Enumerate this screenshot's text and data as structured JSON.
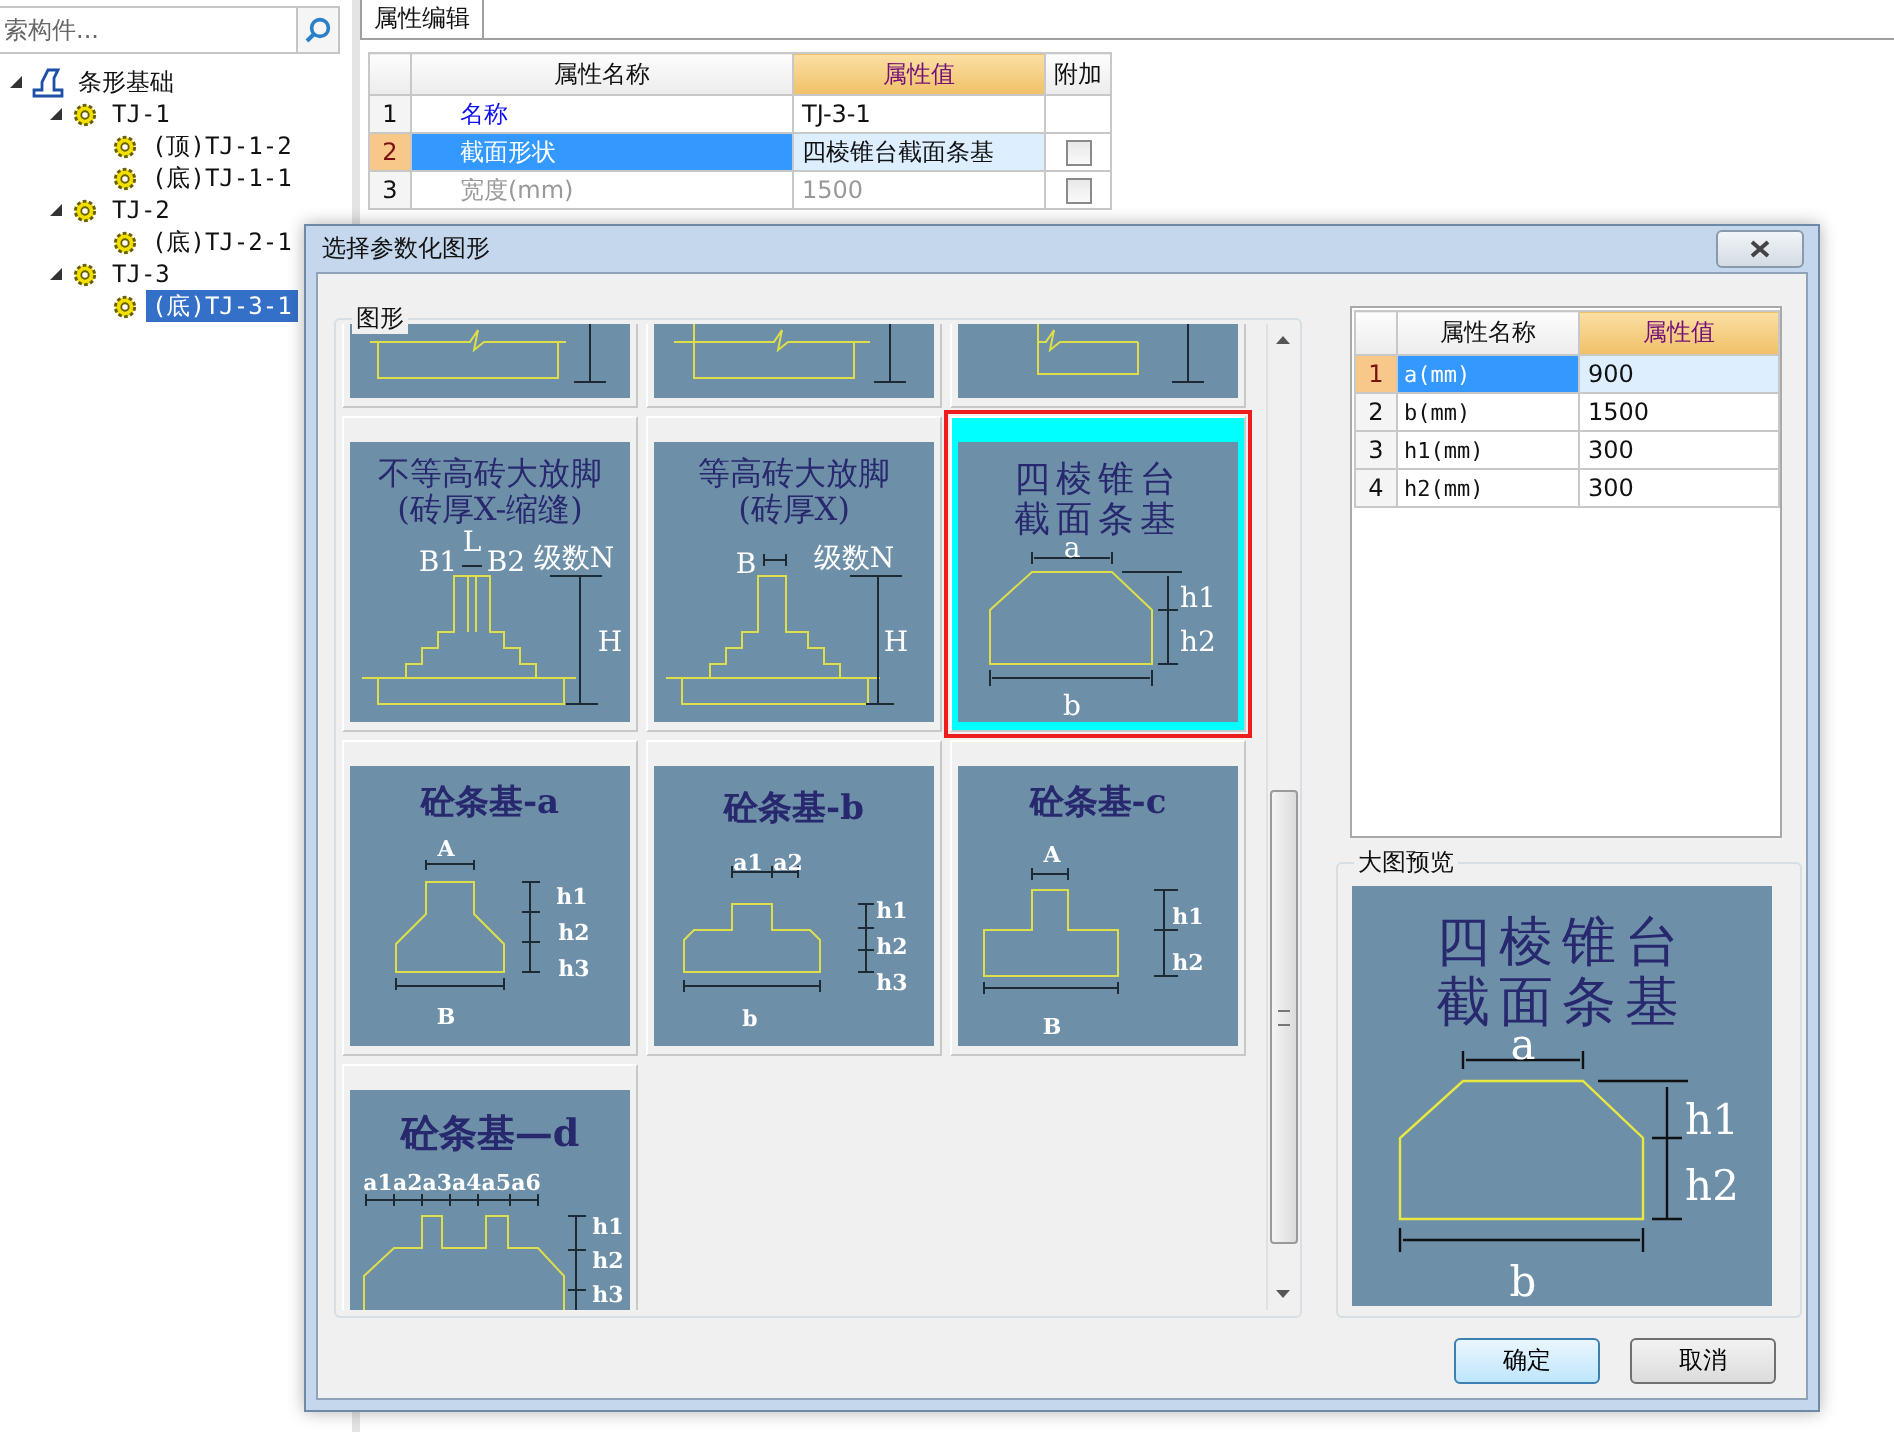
{
  "search": {
    "placeholder": "索构件..."
  },
  "tree": [
    {
      "label": "条形基础",
      "kind": "folder",
      "expanded": true,
      "selected": false,
      "children": [
        {
          "label": "TJ-1",
          "kind": "component",
          "expanded": true,
          "selected": false,
          "children": [
            {
              "label": "(顶)TJ-1-2",
              "kind": "component",
              "selected": false
            },
            {
              "label": "(底)TJ-1-1",
              "kind": "component",
              "selected": false
            }
          ]
        },
        {
          "label": "TJ-2",
          "kind": "component",
          "expanded": true,
          "selected": false,
          "children": [
            {
              "label": "(底)TJ-2-1",
              "kind": "component",
              "selected": false
            }
          ]
        },
        {
          "label": "TJ-3",
          "kind": "component",
          "expanded": true,
          "selected": false,
          "children": [
            {
              "label": "(底)TJ-3-1",
              "kind": "component",
              "selected": true
            }
          ]
        }
      ]
    }
  ],
  "property_editor": {
    "tab": "属性编辑",
    "columns": [
      "属性名称",
      "属性值",
      "附加"
    ],
    "rows": [
      {
        "number": "1",
        "name": "名称",
        "value": "TJ-3-1",
        "kind": "label",
        "selected": false,
        "disabled": false
      },
      {
        "number": "2",
        "name": "截面形状",
        "value": "四棱锥台截面条基",
        "kind": "option",
        "selected": true,
        "disabled": false,
        "checked": false
      },
      {
        "number": "3",
        "name": "宽度(mm)",
        "value": "1500",
        "kind": "option",
        "selected": false,
        "disabled": true,
        "checked": false
      }
    ]
  },
  "dialog": {
    "title": "选择参数化图形",
    "shapes": {
      "label": "图形",
      "cards": [
        {
          "kind": "cutoff-a",
          "selected": false
        },
        {
          "kind": "cutoff-b",
          "selected": false
        },
        {
          "kind": "cutoff-c",
          "selected": false
        },
        {
          "kind": "brick-joint",
          "selected": false,
          "title": [
            "不等高砖大放脚",
            "(砖厚X-缩缝)"
          ],
          "labels": [
            "B1",
            "L",
            "B2",
            "级数N",
            "H"
          ]
        },
        {
          "kind": "brick",
          "selected": false,
          "title": [
            "等高砖大放脚",
            "(砖厚X)"
          ],
          "labels": [
            "B",
            "级数N",
            "H"
          ]
        },
        {
          "kind": "pyramid",
          "selected": true,
          "title": [
            "四棱锥台",
            "截面条基"
          ],
          "labels": [
            "a",
            "h1",
            "h2",
            "b"
          ]
        },
        {
          "kind": "concrete-a",
          "selected": false,
          "title": [
            "砼条基-a"
          ],
          "labels": [
            "A",
            "h1",
            "h2",
            "h3",
            "B"
          ]
        },
        {
          "kind": "concrete-b",
          "selected": false,
          "title": [
            "砼条基-b"
          ],
          "labels": [
            "a1",
            "a2",
            "h1",
            "h2",
            "h3",
            "b"
          ]
        },
        {
          "kind": "concrete-c",
          "selected": false,
          "title": [
            "砼条基-c"
          ],
          "labels": [
            "A",
            "h1",
            "h2",
            "B"
          ]
        },
        {
          "kind": "concrete-d",
          "selected": false,
          "title": [
            "砼条基—d"
          ],
          "labels": [
            "a1a2a3a4a5a6",
            "h1",
            "h2",
            "h3"
          ]
        }
      ]
    },
    "properties": {
      "columns": [
        "属性名称",
        "属性值"
      ],
      "rows": [
        {
          "number": "1",
          "name": "a(mm)",
          "value": "900",
          "selected": true
        },
        {
          "number": "2",
          "name": "b(mm)",
          "value": "1500",
          "selected": false
        },
        {
          "number": "3",
          "name": "h1(mm)",
          "value": "300",
          "selected": false
        },
        {
          "number": "4",
          "name": "h2(mm)",
          "value": "300",
          "selected": false
        }
      ]
    },
    "preview": {
      "label": "大图预览",
      "kind": "pyramid",
      "title": [
        "四棱锥台",
        "截面条基"
      ],
      "labels": [
        "a",
        "h1",
        "h2",
        "b"
      ]
    },
    "buttons": [
      {
        "label": "确定",
        "default": true
      },
      {
        "label": "取消",
        "default": false
      }
    ]
  }
}
